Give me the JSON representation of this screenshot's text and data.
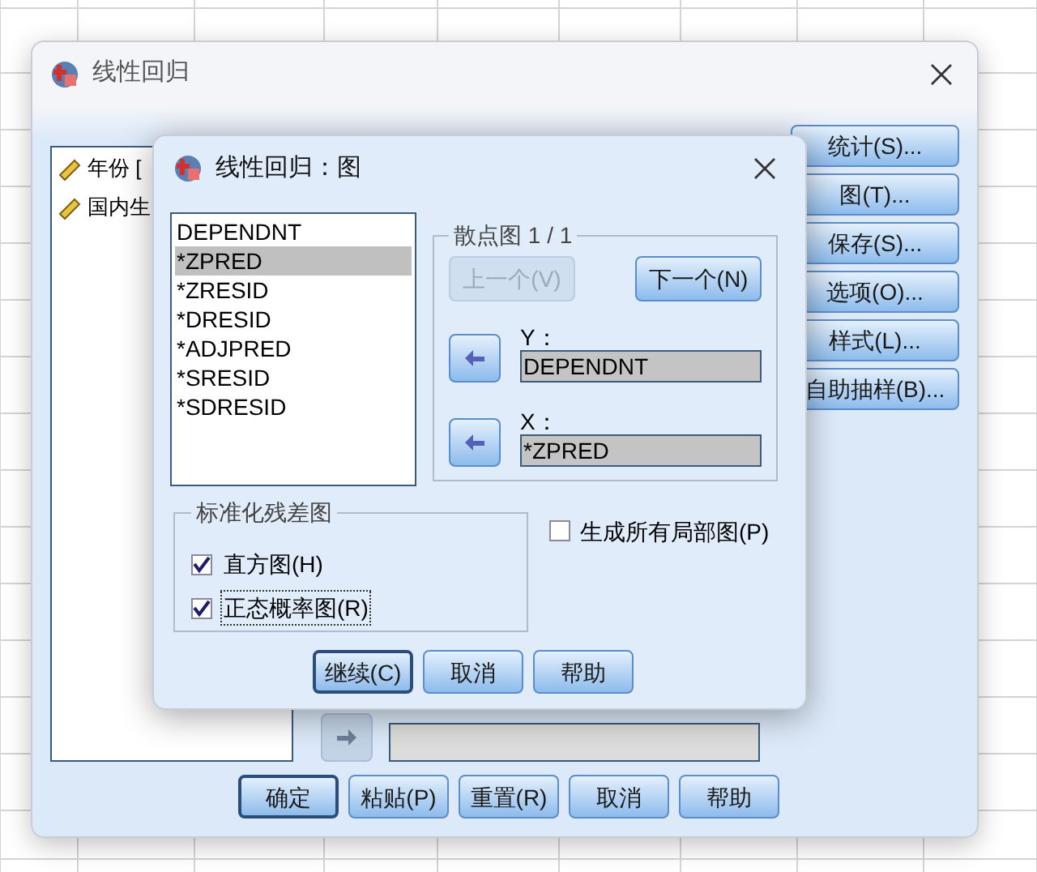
{
  "main_window": {
    "title": "线性回归",
    "variables": [
      {
        "label": "年份 ["
      },
      {
        "label": "国内生"
      }
    ],
    "side_buttons": [
      {
        "label": "统计(S)..."
      },
      {
        "label": "图(T)..."
      },
      {
        "label": "保存(S)..."
      },
      {
        "label": "选项(O)..."
      },
      {
        "label": "样式(L)..."
      },
      {
        "label": "自助抽样(B)..."
      }
    ],
    "wls_arrow_disabled": true,
    "buttons": [
      {
        "label": "确定",
        "default": true
      },
      {
        "label": "粘贴(P)",
        "default": false
      },
      {
        "label": "重置(R)",
        "default": false
      },
      {
        "label": "取消",
        "default": false
      },
      {
        "label": "帮助",
        "default": false
      }
    ]
  },
  "plots_dialog": {
    "title": "线性回归：图",
    "variables": [
      {
        "label": "DEPENDNT",
        "selected": false
      },
      {
        "label": "*ZPRED",
        "selected": true
      },
      {
        "label": "*ZRESID",
        "selected": false
      },
      {
        "label": "*DRESID",
        "selected": false
      },
      {
        "label": "*ADJPRED",
        "selected": false
      },
      {
        "label": "*SRESID",
        "selected": false
      },
      {
        "label": "*SDRESID",
        "selected": false
      }
    ],
    "scatter": {
      "title": "散点图 1 / 1",
      "previous": {
        "label": "上一个(V)",
        "disabled": true
      },
      "next": {
        "label": "下一个(N)",
        "disabled": false
      },
      "fields": [
        {
          "label": "Y：",
          "value": "DEPENDNT"
        },
        {
          "label": "X：",
          "value": "*ZPRED"
        }
      ]
    },
    "residual_plots": {
      "title": "标准化残差图",
      "options": [
        {
          "label": "直方图(H)",
          "checked": true,
          "focused": false
        },
        {
          "label": "正态概率图(R)",
          "checked": true,
          "focused": true
        }
      ]
    },
    "partial_plots": {
      "label": "生成所有局部图(P)",
      "checked": false
    },
    "buttons": [
      {
        "label": "继续(C)",
        "default": true
      },
      {
        "label": "取消",
        "default": false
      },
      {
        "label": "帮助",
        "default": false
      }
    ]
  }
}
